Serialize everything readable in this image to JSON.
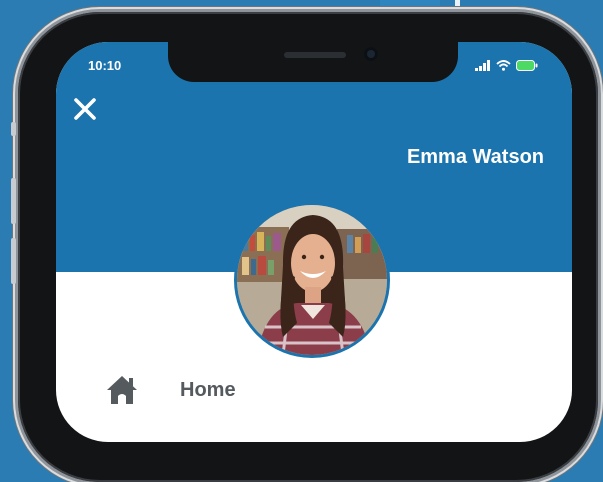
{
  "status_bar": {
    "time": "10:10",
    "icons": [
      "signal-icon",
      "wifi-icon",
      "battery-icon"
    ],
    "battery_color": "#4cd964"
  },
  "header": {
    "background_color": "#1b74ad",
    "close_icon": "close-icon",
    "user_name": "Emma Watson"
  },
  "profile": {
    "avatar": "profile-photo",
    "border_color": "#1b74ad"
  },
  "menu": {
    "items": [
      {
        "icon": "home-icon",
        "label": "Home"
      }
    ]
  }
}
